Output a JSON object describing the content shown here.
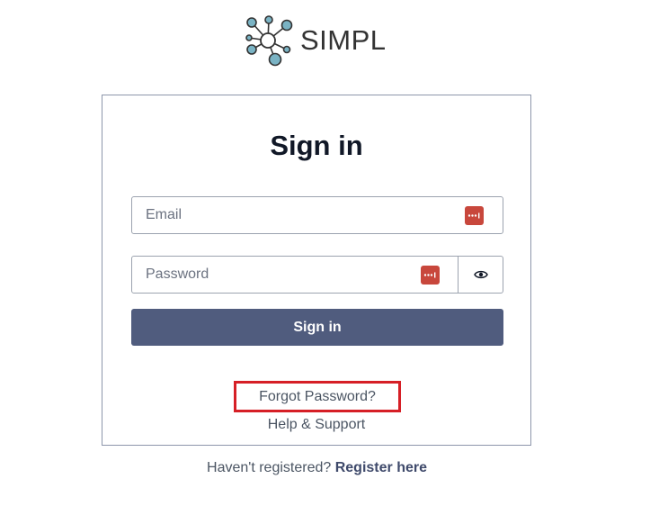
{
  "brand": {
    "name": "SIMPL",
    "logo_icon": "network-nodes-icon",
    "node_color": "#7ab3c4"
  },
  "signin": {
    "title": "Sign in",
    "email_placeholder": "Email",
    "password_placeholder": "Password",
    "submit_label": "Sign in",
    "password_manager_icon": "password-manager-icon",
    "password_manager_color": "#c8473c",
    "toggle_icon": "eye-icon",
    "button_color": "#505c7e"
  },
  "links": {
    "forgot_password": "Forgot Password?",
    "help_support": "Help & Support",
    "highlight_color": "#d61f26"
  },
  "register": {
    "prompt": "Haven't registered?",
    "link_label": "Register here"
  }
}
